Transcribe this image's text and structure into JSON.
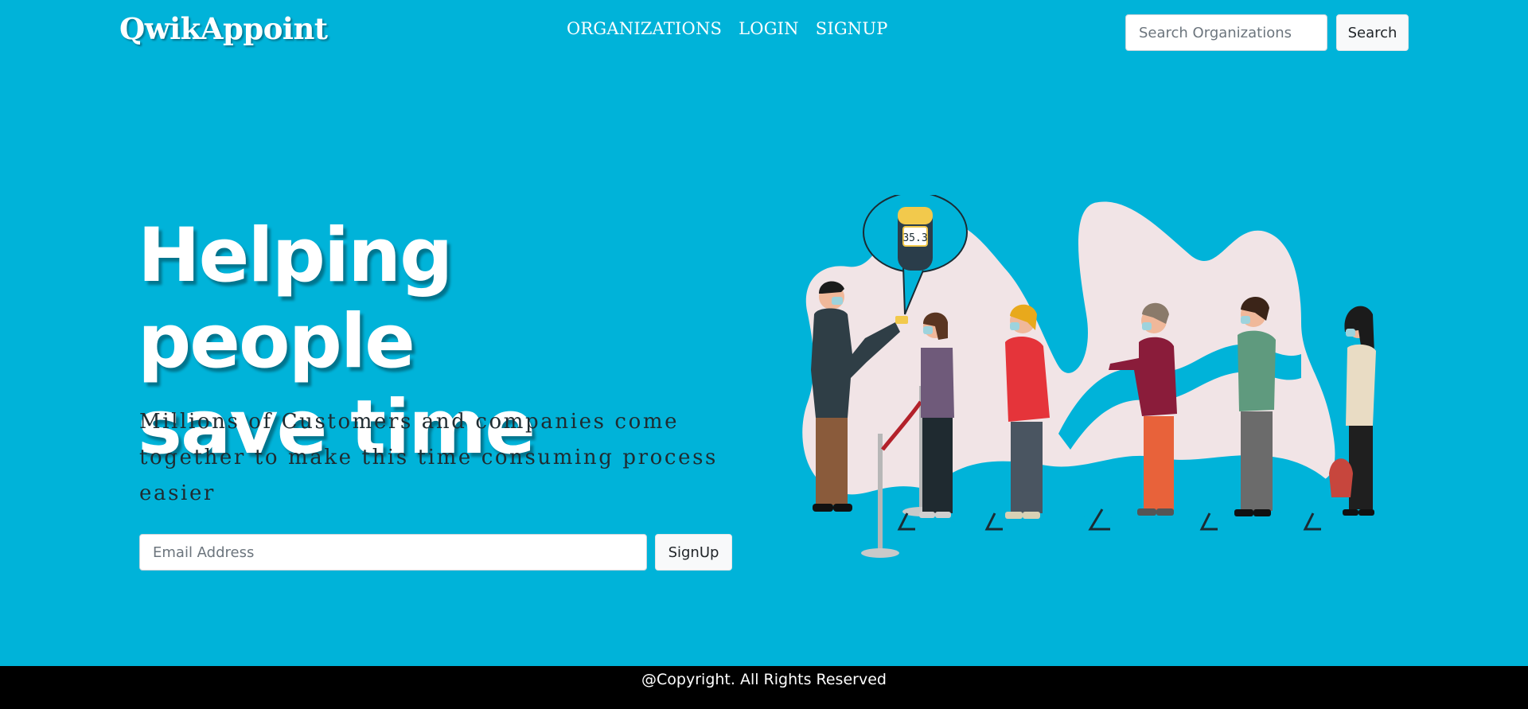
{
  "navbar": {
    "brand": "QwikAppoint",
    "links": [
      "ORGANIZATIONS",
      "LOGIN",
      "SIGNUP"
    ],
    "search": {
      "placeholder": "Search Organizations",
      "value": "",
      "button_label": "Search"
    }
  },
  "hero": {
    "title_lines": [
      "Helping people",
      "save time"
    ],
    "subtitle": "Millions of Customers and companies come together to make this time consuming process easier",
    "email": {
      "placeholder": "Email Address",
      "value": "",
      "button_label": "SignUp"
    }
  },
  "illustration": {
    "description_icon": "queue-people-temperature-check-illustration",
    "thermometer_reading": "35.3"
  },
  "footer": {
    "text": "@Copyright. All Rights Reserved"
  },
  "colors": {
    "background": "#00b3d9",
    "footer": "#000000",
    "text_light": "#ffffff",
    "blob": "#f1e4e6"
  }
}
